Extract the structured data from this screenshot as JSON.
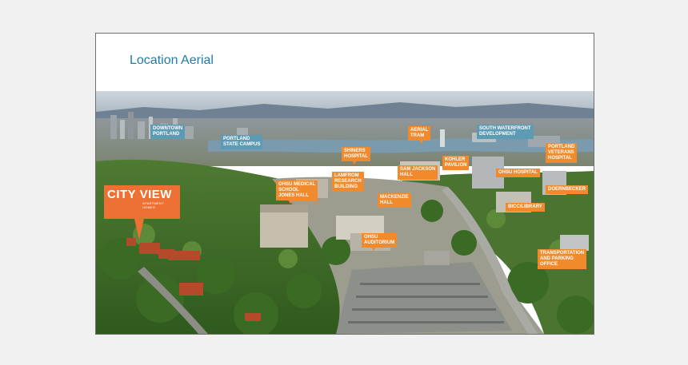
{
  "slide": {
    "title": "Location Aerial"
  },
  "brand": {
    "name": "CITY VIEW",
    "tagline": "APARTMENT HOMES",
    "color": "#ed7034"
  },
  "labels": {
    "downtown_portland": "DOWNTOWN\nPORTLAND",
    "portland_state_campus": "PORTLAND\nSTATE CAMPUS",
    "aerial_tram": "AERIAL\nTRAM",
    "south_waterfront": "SOUTH WATERFRONT\nDEVELOPMENT",
    "shriners_hospital": "SHINERS\nHOSPITAL",
    "kohler_pavilion": "KOHLER\nPAVILION",
    "portland_veterans_hospital": "PORTLAND\nVETERANS\nHOSPITAL",
    "sam_jackson_hall": "SAM JACKSON\nHALL",
    "ohsu_hospital": "OHSU HOSPITAL",
    "lamfrom_research": "LAMFROM\nRESEARCH\nBUILDING",
    "ohsu_medical_school": "OHSU MEDICAL\nSCHOOL\nJONES HALL",
    "doernbecker": "DOERNBECKER",
    "mackenzie_hall": "MACKENZIE\nHALL",
    "bicc_library": "BICC/LIBRARY",
    "ohsu_auditorium": "OHSU\nAUDITORIUM",
    "transportation_parking": "TRANSPORTATION\nAND PARKING\nOFFICE"
  },
  "colors": {
    "title": "#1f7ea1",
    "label_orange": "#f08a2c",
    "label_blue": "#5d9bb4"
  }
}
